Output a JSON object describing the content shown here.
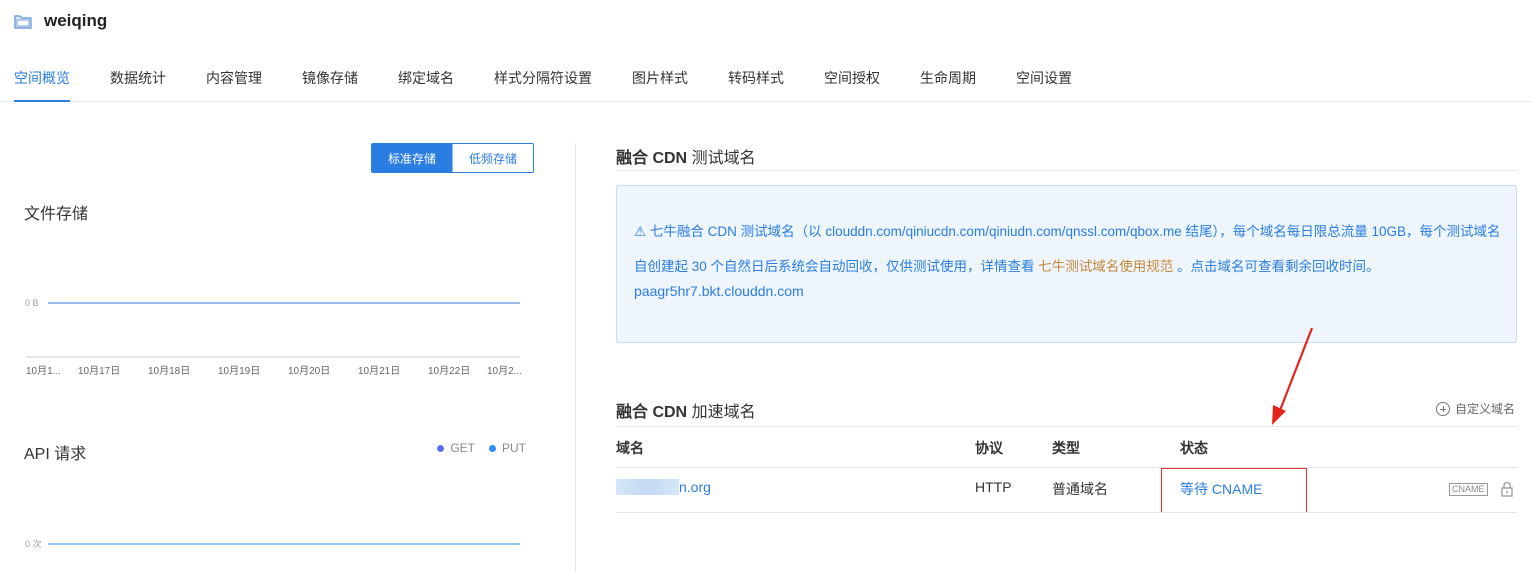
{
  "header": {
    "bucket_name": "weiqing",
    "icon": "folder-icon"
  },
  "tabs": [
    "空间概览",
    "数据统计",
    "内容管理",
    "镜像存储",
    "绑定域名",
    "样式分隔符设置",
    "图片样式",
    "转码样式",
    "空间授权",
    "生命周期",
    "空间设置"
  ],
  "active_tab": "空间概览",
  "storage_toggle": {
    "standard": "标准存储",
    "low_freq": "低频存储",
    "selected": "标准存储"
  },
  "file_storage": {
    "title": "文件存储",
    "chart_data": {
      "type": "line",
      "categories": [
        "10月1...",
        "10月17日",
        "10月18日",
        "10月19日",
        "10月20日",
        "10月21日",
        "10月22日",
        "10月2..."
      ],
      "series": [
        {
          "values": [
            0,
            0,
            0,
            0,
            0,
            0,
            0,
            0
          ]
        }
      ],
      "y_tick_label": "0 B",
      "color": "#2a7de1"
    }
  },
  "api_requests": {
    "title": "API 请求",
    "legend": [
      {
        "name": "GET",
        "color": "#5b6ef0"
      },
      {
        "name": "PUT",
        "color": "#2a8ff0"
      }
    ],
    "chart_data": {
      "type": "line",
      "y_tick_label": "0 次",
      "series": [
        {
          "name": "GET",
          "values": [
            0,
            0,
            0,
            0,
            0,
            0,
            0,
            0
          ]
        },
        {
          "name": "PUT",
          "values": [
            0,
            0,
            0,
            0,
            0,
            0,
            0,
            0
          ]
        }
      ]
    }
  },
  "test_domain": {
    "title_bold": "融合 CDN",
    "title_rest": " 测试域名",
    "notice_icon": "warning-icon",
    "notice_part1": "⚠ 七牛融合 CDN 测试域名（以 clouddn.com/qiniucdn.com/qiniudn.com/qnssl.com/qbox.me 结尾），每个域名每日限总流量 10GB，每个测试域名自创建起 30 个自然日后系统会自动回收，仅供测试使用，详情查看 ",
    "notice_link": "七牛测试域名使用规范",
    "notice_part2": " 。点击域名可查看剩余回收时间。",
    "domain": "paagr5hr7.bkt.clouddn.com"
  },
  "accel_domain": {
    "title_bold": "融合 CDN",
    "title_rest": " 加速域名",
    "custom_domain_label": "自定义域名",
    "columns": [
      "域名",
      "协议",
      "类型",
      "状态"
    ],
    "rows": [
      {
        "domain_suffix": "n.org",
        "protocol": "HTTP",
        "type": "普通域名",
        "status": "等待 CNAME",
        "tag": "CNAME"
      }
    ]
  },
  "colors": {
    "accent": "#2a7de1",
    "link_orange": "#c8883a",
    "highlight_red": "#e0312b"
  }
}
